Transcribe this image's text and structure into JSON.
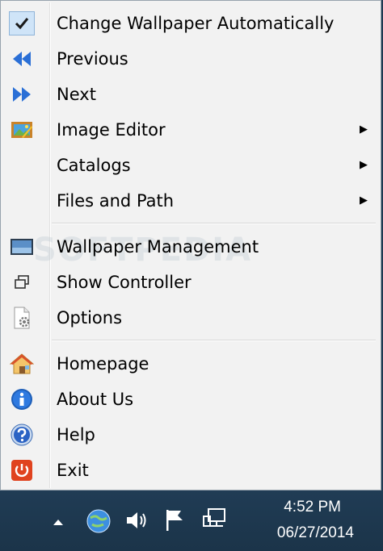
{
  "menu": {
    "items": [
      {
        "label": "Change Wallpaper Automatically",
        "icon": "checkmark-icon",
        "checked": true
      },
      {
        "label": "Previous",
        "icon": "rewind-icon"
      },
      {
        "label": "Next",
        "icon": "fast-forward-icon"
      },
      {
        "label": "Image Editor",
        "icon": "image-editor-icon",
        "submenu": true
      },
      {
        "label": "Catalogs",
        "submenu": true
      },
      {
        "label": "Files and Path",
        "submenu": true
      },
      {
        "label": "Wallpaper Management",
        "icon": "monitor-icon"
      },
      {
        "label": "Show Controller",
        "icon": "restore-window-icon"
      },
      {
        "label": "Options",
        "icon": "settings-document-icon"
      },
      {
        "label": "Homepage",
        "icon": "house-icon"
      },
      {
        "label": "About Us",
        "icon": "info-icon"
      },
      {
        "label": "Help",
        "icon": "help-icon"
      },
      {
        "label": "Exit",
        "icon": "power-icon"
      }
    ],
    "submenu_arrow": "▶",
    "watermark": "SOFTPEDIA"
  },
  "taskbar": {
    "clock_time": "4:52 PM",
    "clock_date": "06/27/2014",
    "tray_icons": [
      "show-hidden-icons-arrow-icon",
      "globe-app-icon",
      "speaker-icon",
      "action-center-flag-icon",
      "network-icon"
    ]
  },
  "colors": {
    "menu_bg": "#f2f2f2",
    "check_highlight": "#cfe4f8",
    "taskbar_bg": "#1f3a52",
    "icon_blue": "#2a6fd6",
    "exit_red": "#e0431f"
  }
}
